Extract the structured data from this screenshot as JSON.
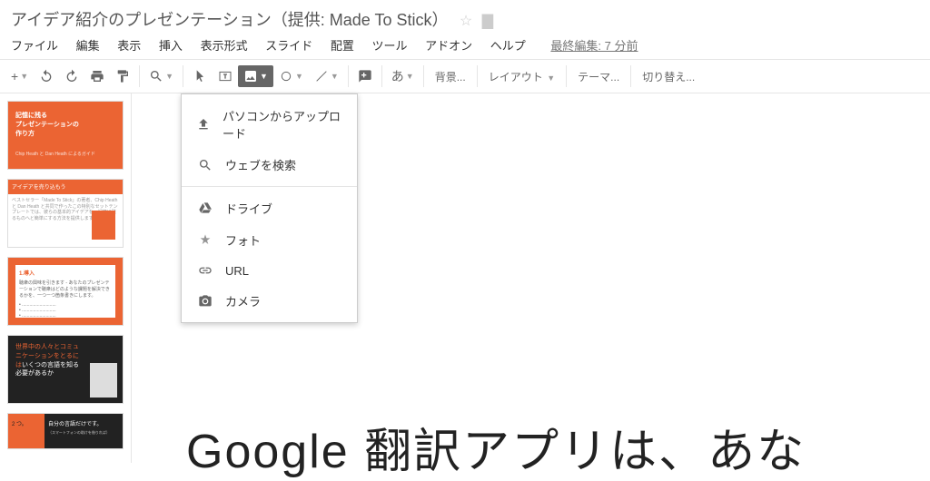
{
  "title": "アイデア紹介のプレゼンテーション（提供: Made To Stick）",
  "menu": {
    "file": "ファイル",
    "edit": "編集",
    "view": "表示",
    "insert": "挿入",
    "format": "表示形式",
    "slide": "スライド",
    "arrange": "配置",
    "tools": "ツール",
    "addons": "アドオン",
    "help": "ヘルプ",
    "lastEdit": "最終編集: 7 分前"
  },
  "toolbar": {
    "background": "背景...",
    "layout": "レイアウト",
    "theme": "テーマ...",
    "transition": "切り替え..."
  },
  "dropdown": {
    "upload": "パソコンからアップロード",
    "search": "ウェブを検索",
    "drive": "ドライブ",
    "photos": "フォト",
    "url": "URL",
    "camera": "カメラ"
  },
  "thumbs": {
    "t1": {
      "line1": "記憶に残る",
      "line2": "プレゼンテーションの",
      "line3": "作り方",
      "sub": "Chip Heath と Dan Heath によるガイド"
    },
    "t2": {
      "title": "アイデアを売り込もう",
      "body": "ベストセラー「Made To Stick」の著者、Chip Heath と Dan Heath と共同で作ったこの特別なセットテンプレートでは、彼らの基本的アイデアを、記憶に残るものへと簡単にする方法を提供します。"
    },
    "t3": {
      "title": "1.導入",
      "body": "聴衆の興味を引きます - あなたのプレゼンテーションで聴衆はどのような課題を解決できるかを、一つーつ箇条書きにします。"
    },
    "t4": {
      "l1": "世界中の人々とコミュ",
      "l2": "ニケーションをとるに",
      "l3a": "は",
      "l3b": "いくつの言語を知る",
      "l4": "必要があるか"
    },
    "t5": {
      "left": "2 つ。",
      "right": "自分の言語だけです。",
      "sub": "（スマートフォンの助けを借りれば）"
    }
  },
  "slideText": "Google 翻訳アプリは、あな"
}
